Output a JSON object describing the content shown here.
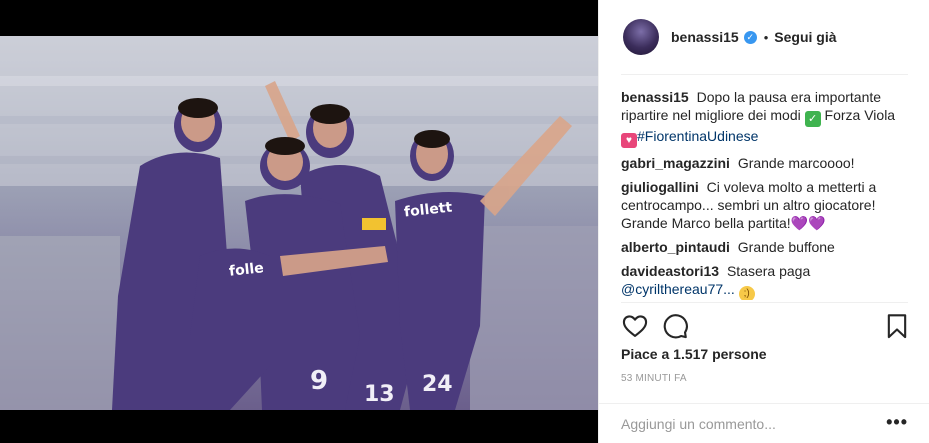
{
  "post": {
    "header": {
      "username": "benassi15",
      "verified_icon": "verified-badge-icon",
      "separator": "•",
      "follow_label": "Segui già"
    },
    "photo": {
      "jersey_brand": "folle",
      "brand_text_1": "follett",
      "numbers": [
        "9",
        "13",
        "24"
      ]
    },
    "caption": {
      "author": "benassi15",
      "text_part_1": "Dopo la pausa era importante ripartire nel migliore dei modi",
      "check_emoji": "✓",
      "text_part_2": "Forza Viola",
      "heart_emoji": "♥",
      "hashtag": "#FiorentinaUdinese"
    },
    "comments": [
      {
        "author": "gabri_magazzini",
        "text": "Grande marcoooo!"
      },
      {
        "author": "giuliogallini",
        "text": "Ci voleva molto a metterti a centrocampo... sembri un altro giocatore! Grande Marco bella partita!",
        "emoji": "💜💜"
      },
      {
        "author": "alberto_pintaudi",
        "text": "Grande buffone"
      },
      {
        "author": "davideastori13",
        "text": "Stasera paga",
        "mention": "@cyrilthereau77...",
        "emoji": "😉"
      }
    ],
    "icons": {
      "like": "heart-icon",
      "comment": "comment-icon",
      "save": "bookmark-icon",
      "more": "more-options-icon"
    },
    "likes_text": "Piace a 1.517 persone",
    "time_text": "53 minuti fa",
    "comment_input": {
      "placeholder": "Aggiungi un commento...",
      "value": "",
      "more_label": "•••"
    }
  }
}
